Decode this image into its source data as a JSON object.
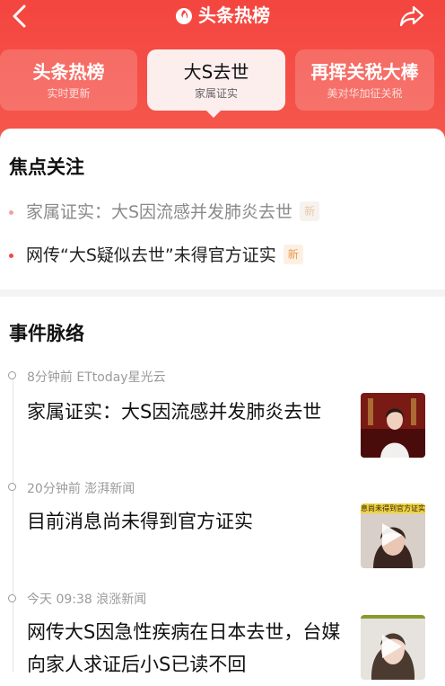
{
  "header": {
    "brand_title": "头条热榜",
    "back_icon": "chevron-left-icon",
    "share_icon": "share-icon",
    "logo_icon": "flame-icon",
    "colors": {
      "accent": "#f4453f",
      "badge_bg": "#fdf0e3",
      "badge_text": "#e89a52"
    }
  },
  "tabs": [
    {
      "title": "头条热榜",
      "subtitle": "实时更新",
      "active": false
    },
    {
      "title": "大S去世",
      "subtitle": "家属证实",
      "active": true
    },
    {
      "title": "再挥关税大棒",
      "subtitle": "美对华加征关税",
      "active": false
    }
  ],
  "focus": {
    "title": "焦点关注",
    "items": [
      {
        "text": "家属证实：大S因流感并发肺炎去世",
        "badge": "新",
        "read": true
      },
      {
        "text": "网传“大S疑似去世”未得官方证实",
        "badge": "新",
        "read": false
      }
    ]
  },
  "timeline": {
    "title": "事件脉络",
    "events": [
      {
        "time": "8分钟前",
        "source": "ETtoday星光云",
        "headline": "家属证实：大S因流感并发肺炎去世",
        "thumb_type": "photo"
      },
      {
        "time": "20分钟前",
        "source": "澎湃新闻",
        "headline": "目前消息尚未得到官方证实",
        "thumb_type": "video",
        "thumb_caption": "息尚未得到官方证实"
      },
      {
        "time": "今天 09:38",
        "source": "浪涨新闻",
        "headline": "网传大S因急性疾病在日本去世，台媒向家人求证后小S已读不回",
        "thumb_type": "video"
      }
    ]
  }
}
